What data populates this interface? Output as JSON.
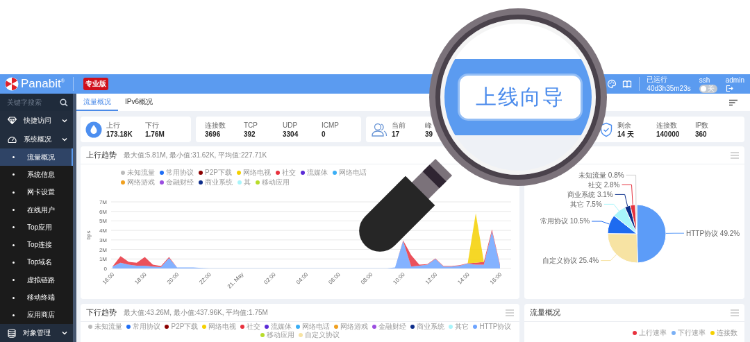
{
  "header": {
    "logo": "Panabit$^{®}$",
    "edition_badge": "专业版",
    "uptime_label": "已运行",
    "uptime": "40d3h35m23s",
    "ssh": {
      "label": "ssh",
      "on": false,
      "state_text": "关"
    },
    "user": "admin"
  },
  "magnifier": {
    "button": "上线向导"
  },
  "sidebar": {
    "search": {
      "placeholder": "关键字搜索"
    },
    "items": [
      {
        "label": "快捷访问"
      },
      {
        "label": "系统概况",
        "children": [
          {
            "label": "流量概况",
            "selected": true
          },
          {
            "label": "系统信息",
            "selected": false
          },
          {
            "label": "网卡设置",
            "selected": false
          },
          {
            "label": "在线用户",
            "selected": false
          },
          {
            "label": "Top应用",
            "selected": false
          },
          {
            "label": "Top连接",
            "selected": false
          },
          {
            "label": "Top域名",
            "selected": false
          },
          {
            "label": "虚拟链路",
            "selected": false
          },
          {
            "label": "移动终端",
            "selected": false
          },
          {
            "label": "应用商店",
            "selected": false
          }
        ]
      },
      {
        "label": "对象管理"
      }
    ]
  },
  "tabs": [
    {
      "label": "流量概况",
      "selected": true
    },
    {
      "label": "IPv6概况",
      "selected": false
    }
  ],
  "stat_cards": [
    {
      "fields": [
        {
          "label": "上行",
          "value": "173.18K"
        },
        {
          "label": "下行",
          "value": "1.76M"
        }
      ]
    },
    {
      "fields": [
        {
          "label": "连接数",
          "value": "3696"
        },
        {
          "label": "TCP",
          "value": "392"
        },
        {
          "label": "UDP",
          "value": "3304"
        },
        {
          "label": "ICMP",
          "value": "0"
        }
      ]
    },
    {
      "fields": [
        {
          "label": "当前",
          "value": "17"
        },
        {
          "label": "峰",
          "value": "39"
        }
      ]
    },
    {
      "fields": [
        {
          "label": "剩余",
          "value": "14 天"
        },
        {
          "label": "连接数",
          "value": "140000"
        },
        {
          "label": "IP数",
          "value": "360"
        }
      ]
    }
  ],
  "upstream_panel": {
    "title": "上行趋势",
    "summary": "最大值:5.81M, 最小值:31.62K, 平均值:227.71K",
    "legend": [
      {
        "label": "未知流量",
        "color": "#bbbbbb"
      },
      {
        "label": "常用协议",
        "color": "#1f6ef5"
      },
      {
        "label": "P2P下载",
        "color": "#8b0000"
      },
      {
        "label": "网络电视",
        "color": "#f5d000"
      },
      {
        "label": "社交",
        "color": "#e8323e"
      },
      {
        "label": "流媒体",
        "color": "#5b2bd6"
      },
      {
        "label": "网络电话",
        "color": "#3aaef5"
      },
      {
        "label": "网络游戏",
        "color": "#f0a020"
      },
      {
        "label": "金融财经",
        "color": "#9b4de0"
      },
      {
        "label": "商业系统",
        "color": "#0d2d8a"
      },
      {
        "label": "其",
        "color": "#a8f5fb"
      },
      {
        "label": "移动应用",
        "color": "#b8dc2a"
      }
    ],
    "chart_data": {
      "type": "area",
      "stacked": true,
      "grid": true,
      "ylabel": "bps",
      "ylim": [
        0,
        7
      ],
      "categories": [
        "16:00",
        null,
        null,
        null,
        "18:00",
        null,
        null,
        null,
        "20:00",
        null,
        null,
        null,
        "22:00",
        null,
        null,
        null,
        "21. May",
        null,
        null,
        null,
        "02:00",
        null,
        null,
        null,
        "04:00",
        null,
        null,
        null,
        "06:00",
        null,
        null,
        null,
        "08:00",
        null,
        null,
        null,
        "10:00",
        null,
        null,
        null,
        "12:00",
        null,
        null,
        null,
        "14:00",
        null,
        null,
        null,
        "16:00"
      ],
      "yticks": [
        {
          "value": 0,
          "label": "0"
        },
        {
          "value": 1,
          "label": "1M"
        },
        {
          "value": 2,
          "label": "2M"
        },
        {
          "value": 3,
          "label": "3M"
        },
        {
          "value": 4,
          "label": "4M"
        },
        {
          "value": 5,
          "label": "5M"
        },
        {
          "value": 6,
          "label": "6M"
        },
        {
          "value": 7,
          "label": "7M"
        }
      ],
      "series": [
        {
          "color": "#6ea4ff",
          "values": [
            0.2,
            0.6,
            0.4,
            0.3,
            0.3,
            0.2,
            0.15,
            1.1,
            0.1,
            0.12,
            0.1,
            0.05,
            0.02,
            0.02,
            0.02,
            0.02,
            0.02,
            0.02,
            0.02,
            0.02,
            0.02,
            0.02,
            0.02,
            0.02,
            0.02,
            0.02,
            0.02,
            0.02,
            0.02,
            0.02,
            0.02,
            0.02,
            0.02,
            0.02,
            0.02,
            0.1,
            2.9,
            0.2,
            0.3,
            0.4,
            1.0,
            0.2,
            0.2,
            0.3,
            0.5,
            0.4,
            0.4,
            3.9,
            0.3
          ]
        },
        {
          "color": "#e8323e",
          "values": [
            0,
            0.7,
            0.3,
            0.3,
            0.9,
            0.2,
            0.1,
            0.1,
            0,
            0,
            0,
            0,
            0,
            0,
            0,
            0,
            0,
            0,
            0,
            0,
            0,
            0,
            0,
            0,
            0,
            0,
            0,
            0,
            0,
            0,
            0,
            0,
            0,
            0,
            0,
            0,
            0.05,
            1.2,
            0.1,
            0.05,
            0.05,
            0.05,
            0.05,
            0.05,
            0.05,
            0.2,
            0.3,
            0.2,
            0.1
          ]
        },
        {
          "color": "#f5d000",
          "values": [
            0,
            0,
            0,
            0,
            0,
            0,
            0,
            0,
            0,
            0,
            0,
            0,
            0,
            0,
            0,
            0,
            0,
            0,
            0,
            0,
            0,
            0,
            0,
            0,
            0,
            0,
            0,
            0,
            0,
            0,
            0,
            0,
            0,
            0,
            0,
            0,
            0,
            0,
            0,
            0,
            0,
            0,
            0,
            0,
            0,
            5.2,
            0,
            0,
            0
          ]
        }
      ]
    }
  },
  "distribution_panel": {
    "chart_data": {
      "type": "pie",
      "values": [
        49.2,
        25.4,
        10.5,
        7.5,
        3.1,
        2.8,
        0.8
      ],
      "colors": [
        "#5c9cf8",
        "#f7e3a3",
        "#1e6bf0",
        "#a8f5fb",
        "#0b2f8a",
        "#e5323e",
        "#cfcfcf"
      ],
      "value_labels": [
        "HTTP协议 49.2%",
        "自定义协议 25.4%",
        "常用协议 10.5%",
        "其它 7.5%",
        "商业系统 3.1%",
        "社交 2.8%",
        "未知流量 0.8%"
      ]
    }
  },
  "downstream_panel": {
    "title": "下行趋势",
    "summary": "最大值:43.26M, 最小值:437.96K, 平均值:1.75M",
    "legend": [
      {
        "label": "未知流量",
        "color": "#bbbbbb"
      },
      {
        "label": "常用协议",
        "color": "#1f6ef5"
      },
      {
        "label": "P2P下载",
        "color": "#8b0000"
      },
      {
        "label": "网络电视",
        "color": "#f5d000"
      },
      {
        "label": "社交",
        "color": "#e8323e"
      },
      {
        "label": "流媒体",
        "color": "#5b2bd6"
      },
      {
        "label": "网络电话",
        "color": "#3aaef5"
      },
      {
        "label": "网络游戏",
        "color": "#f0a020"
      },
      {
        "label": "金融财经",
        "color": "#9b4de0"
      },
      {
        "label": "商业系统",
        "color": "#0d2d8a"
      },
      {
        "label": "其它",
        "color": "#a8f5fb"
      },
      {
        "label": "HTTP协议",
        "color": "#6ea4ff"
      },
      {
        "label": "移动应用",
        "color": "#b8dc2a"
      },
      {
        "label": "自定义协议",
        "color": "#f7e3a3"
      }
    ]
  },
  "overview_panel": {
    "title": "流量概况",
    "legend": [
      {
        "label": "上行速率",
        "color": "#e8323e"
      },
      {
        "label": "下行速率",
        "color": "#7ab0f5"
      },
      {
        "label": "连接数",
        "color": "#f5d000"
      }
    ]
  }
}
